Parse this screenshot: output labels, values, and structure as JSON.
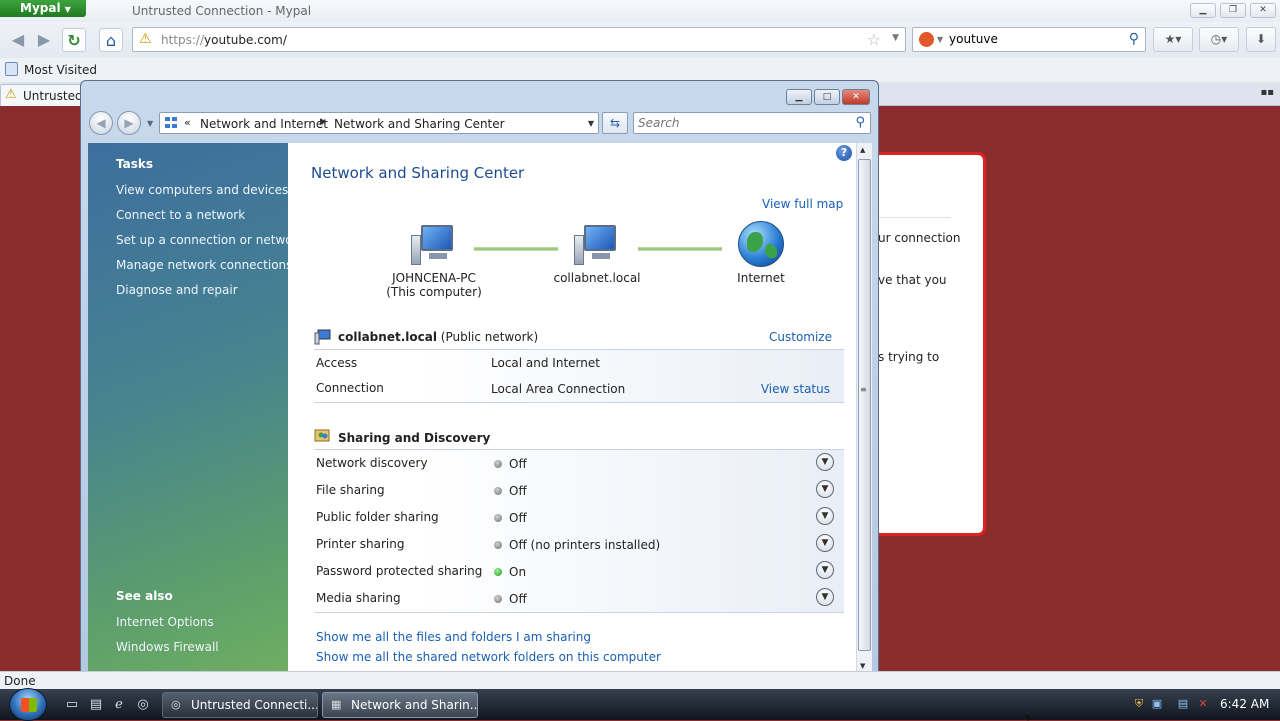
{
  "browser": {
    "app_button": "Mypal",
    "window_title": "Untrusted Connection - Mypal",
    "url_protocol": "https://",
    "url_rest": "youtube.com/",
    "search_value": "youtuve",
    "bookmarks_label": "Most Visited",
    "tab_label": "Untrusted"
  },
  "page_fragments": [
    "ur connection",
    "ve that you",
    "s trying to"
  ],
  "explorer": {
    "breadcrumb": [
      "Network and Internet",
      "Network and Sharing Center"
    ],
    "search_placeholder": "Search",
    "tasks_heading": "Tasks",
    "tasks": [
      "View computers and devices",
      "Connect to a network",
      "Set up a connection or network",
      "Manage network connections",
      "Diagnose and repair"
    ],
    "see_also_heading": "See also",
    "see_also": [
      "Internet Options",
      "Windows Firewall"
    ],
    "title": "Network and Sharing Center",
    "view_full_map": "View full map",
    "map": {
      "computer_name": "JOHNCENA-PC",
      "computer_sub": "(This computer)",
      "network_name": "collabnet.local",
      "internet": "Internet"
    },
    "network": {
      "name": "collabnet.local",
      "type": "(Public network)",
      "customize": "Customize",
      "access_label": "Access",
      "access_value": "Local and Internet",
      "connection_label": "Connection",
      "connection_value": "Local Area Connection",
      "view_status": "View status"
    },
    "sharing": {
      "heading": "Sharing and Discovery",
      "rows": [
        {
          "label": "Network discovery",
          "value": "Off",
          "on": false
        },
        {
          "label": "File sharing",
          "value": "Off",
          "on": false
        },
        {
          "label": "Public folder sharing",
          "value": "Off",
          "on": false
        },
        {
          "label": "Printer sharing",
          "value": "Off (no printers installed)",
          "on": false
        },
        {
          "label": "Password protected sharing",
          "value": "On",
          "on": true
        },
        {
          "label": "Media sharing",
          "value": "Off",
          "on": false
        }
      ]
    },
    "links": [
      "Show me all the files and folders I am sharing",
      "Show me all the shared network folders on this computer"
    ]
  },
  "status_text": "Done",
  "taskbar": {
    "buttons": [
      "Untrusted Connecti...",
      "Network and Sharin..."
    ],
    "clock": "6:42 AM"
  }
}
